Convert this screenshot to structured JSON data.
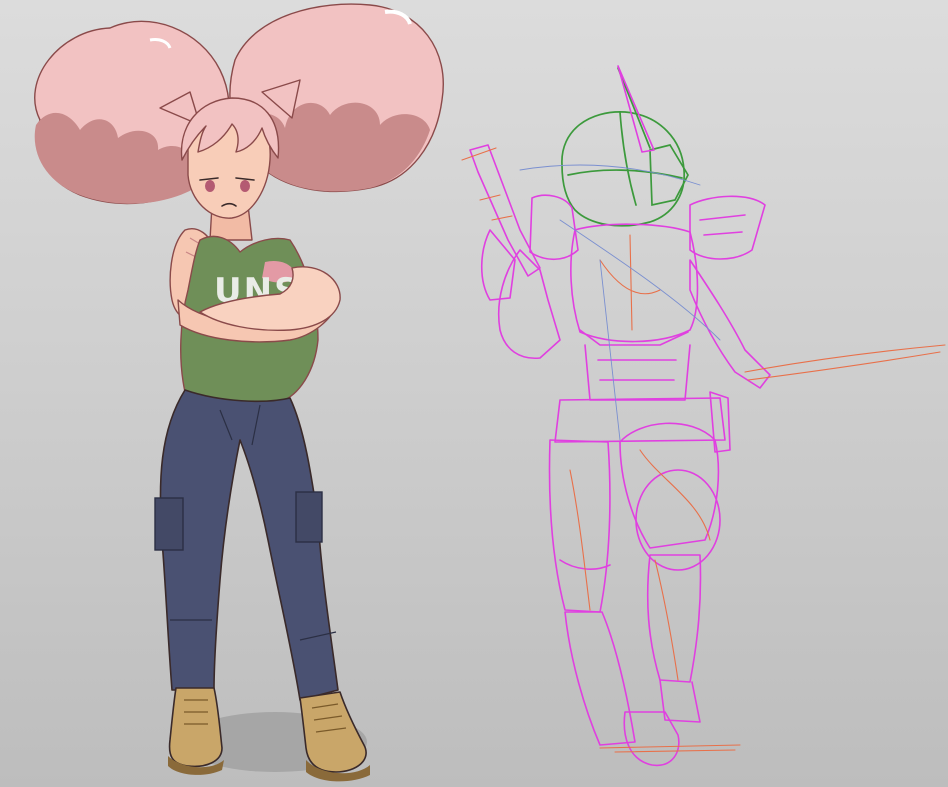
{
  "artwork": {
    "shirt_print": "UNSC"
  },
  "palette": {
    "background_top": "#dcdcdc",
    "background_bottom": "#bdbdbd",
    "hair_light": "#f3c3c3",
    "hair_shadow": "#c98b8b",
    "skin": "#f6c7b2",
    "tank_top": "#6f8f58",
    "pants": "#4a5172",
    "boots": "#c9a669",
    "sketch_magenta": "#e040e0",
    "sketch_orange": "#e8704a",
    "sketch_green": "#3c9a3c"
  }
}
